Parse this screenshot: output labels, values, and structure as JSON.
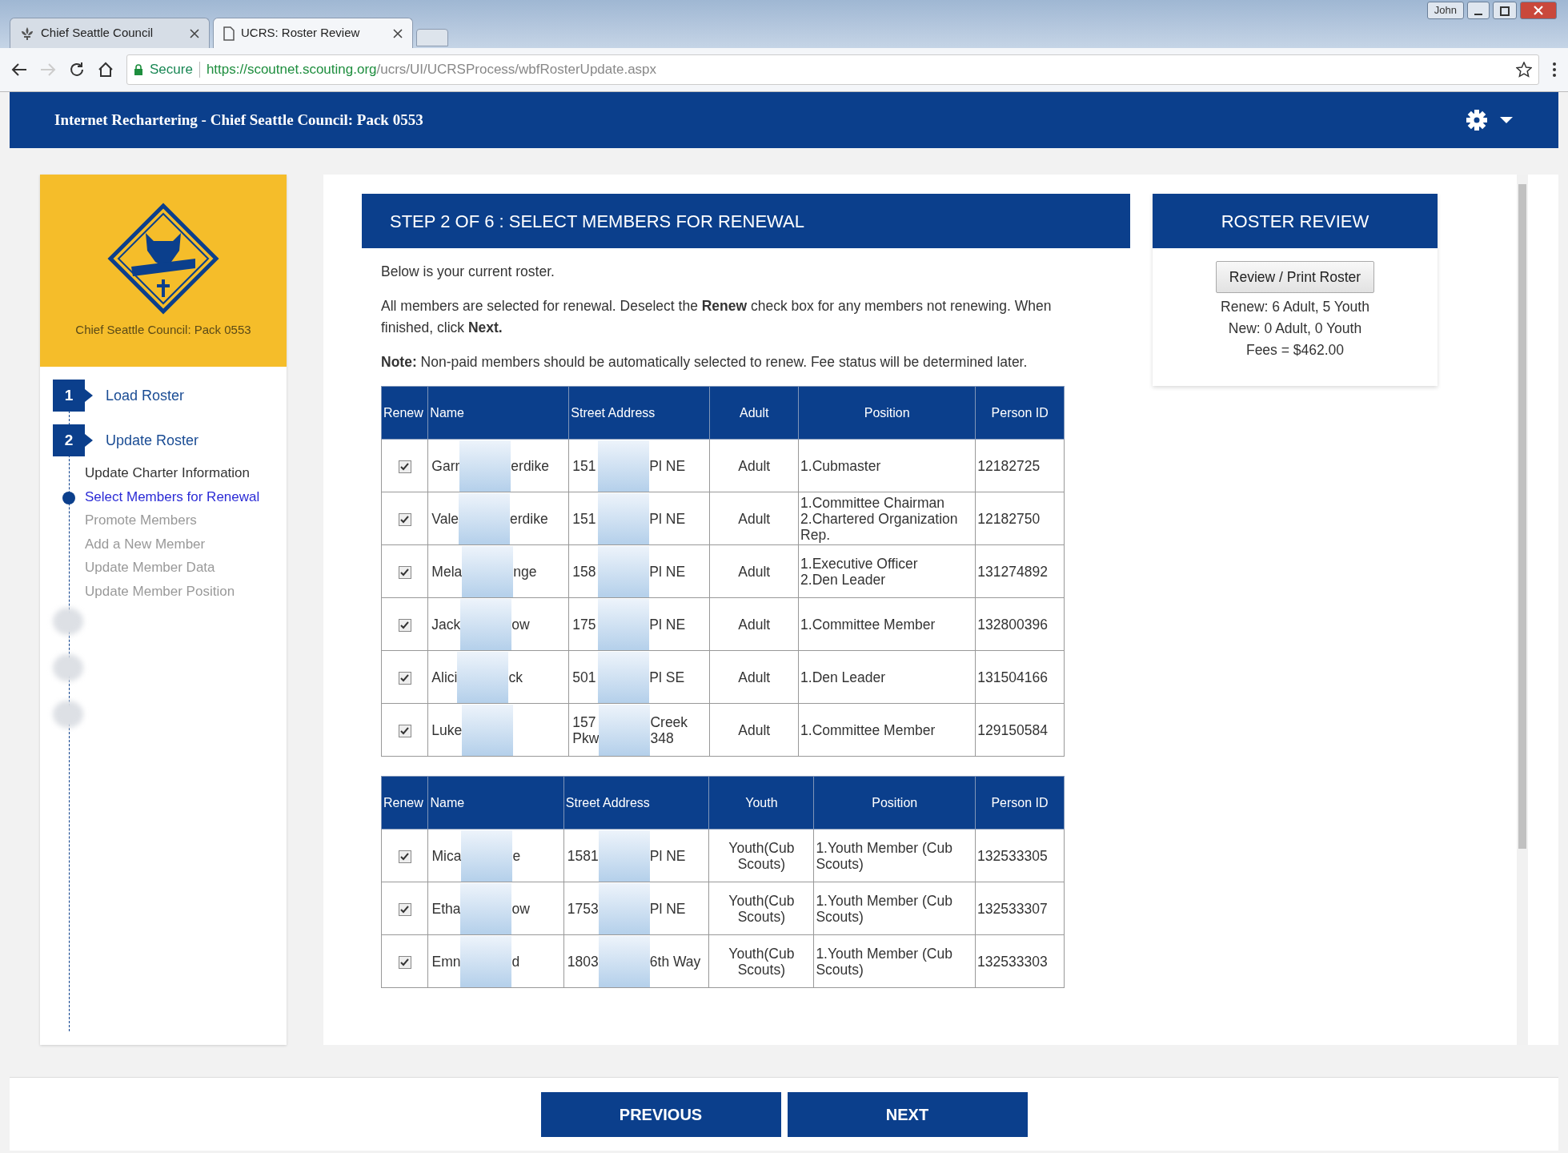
{
  "browser": {
    "user": "John",
    "tabs": [
      {
        "title": "Chief Seattle Council",
        "selected": false
      },
      {
        "title": "UCRS: Roster Review",
        "selected": true
      }
    ],
    "address": {
      "secure_label": "Secure",
      "host": "https://scoutnet.scouting.org",
      "path": "/ucrs/UI/UCRSProcess/wbfRosterUpdate.aspx"
    }
  },
  "header": {
    "title": "Internet Rechartering - Chief Seattle Council: Pack 0553"
  },
  "sidebar": {
    "council_label": "Chief Seattle Council: Pack 0553",
    "steps": [
      {
        "number": "1",
        "label": "Load Roster"
      },
      {
        "number": "2",
        "label": "Update Roster",
        "children": [
          {
            "label": "Update Charter Information",
            "selected": false,
            "disabled": false
          },
          {
            "label": "Select Members for Renewal",
            "selected": true,
            "disabled": false
          },
          {
            "label": "Promote Members",
            "selected": false,
            "disabled": true
          },
          {
            "label": "Add a New Member",
            "selected": false,
            "disabled": true
          },
          {
            "label": "Update Member Data",
            "selected": false,
            "disabled": true
          },
          {
            "label": "Update Member Position",
            "selected": false,
            "disabled": true
          }
        ]
      }
    ]
  },
  "main": {
    "title": "STEP 2 OF 6 : SELECT MEMBERS FOR RENEWAL",
    "paragraphs": [
      "Below is your current roster.",
      "All members are selected for renewal. Deselect the **Renew** check box for any members not renewing. When finished, click **Next.**",
      "**Note:** Non-paid members should be automatically selected to renew. Fee status will be determined later."
    ],
    "tables": [
      {
        "columns": [
          "Renew",
          "Name",
          "Street Address",
          "Adult",
          "Position",
          "Person ID"
        ],
        "rows": [
          {
            "renew": true,
            "name_start": "Garr",
            "name_end": "erdike",
            "address_start": "151",
            "address_end": "Pl NE",
            "type": "Adult",
            "position": [
              "1.Cubmaster"
            ],
            "person_id": "12182725"
          },
          {
            "renew": true,
            "name_start": "Vale",
            "name_end": "erdike",
            "address_start": "151",
            "address_end": "Pl NE",
            "type": "Adult",
            "position": [
              "1.Committee Chairman",
              "2.Chartered Organization Rep."
            ],
            "person_id": "12182750"
          },
          {
            "renew": true,
            "name_start": "Mela",
            "name_end": "nge",
            "address_start": "158",
            "address_end": "Pl NE",
            "type": "Adult",
            "position": [
              "1.Executive Officer",
              "2.Den Leader"
            ],
            "person_id": "131274892"
          },
          {
            "renew": true,
            "name_start": "Jack",
            "name_end": "ow",
            "address_start": "175",
            "address_end": "Pl NE",
            "type": "Adult",
            "position": [
              "1.Committee Member"
            ],
            "person_id": "132800396"
          },
          {
            "renew": true,
            "name_start": "Alici",
            "name_end": "ck",
            "address_start": "501",
            "address_end": "Pl SE",
            "type": "Adult",
            "position": [
              "1.Den Leader"
            ],
            "person_id": "131504166"
          },
          {
            "renew": true,
            "name_start": "Luke",
            "name_end": "",
            "address_start": "157\nPkw",
            "address_end": "Creek\n348",
            "type": "Adult",
            "position": [
              "1.Committee Member"
            ],
            "person_id": "129150584"
          }
        ]
      },
      {
        "columns": [
          "Renew",
          "Name",
          "Street Address",
          "Youth",
          "Position",
          "Person ID"
        ],
        "rows": [
          {
            "renew": true,
            "name_start": "Mica",
            "name_end": "e",
            "address_start": "1581",
            "address_end": "Pl NE",
            "type": "Youth(Cub Scouts)",
            "position": [
              "1.Youth Member (Cub Scouts)"
            ],
            "person_id": "132533305"
          },
          {
            "renew": true,
            "name_start": "Etha",
            "name_end": "ow",
            "address_start": "1753",
            "address_end": "Pl NE",
            "type": "Youth(Cub Scouts)",
            "position": [
              "1.Youth Member (Cub Scouts)"
            ],
            "person_id": "132533307"
          },
          {
            "renew": true,
            "name_start": "Emn",
            "name_end": "d",
            "address_start": "1803",
            "address_end": "6th Way",
            "type": "Youth(Cub Scouts)",
            "position": [
              "1.Youth Member (Cub Scouts)"
            ],
            "person_id": "132533303"
          }
        ]
      }
    ]
  },
  "review": {
    "title": "ROSTER REVIEW",
    "button": "Review / Print Roster",
    "lines": [
      "Renew: 6 Adult, 5 Youth",
      "New: 0 Adult, 0 Youth",
      "Fees = $462.00"
    ]
  },
  "footer": {
    "buttons": [
      "PREVIOUS",
      "NEXT"
    ]
  }
}
